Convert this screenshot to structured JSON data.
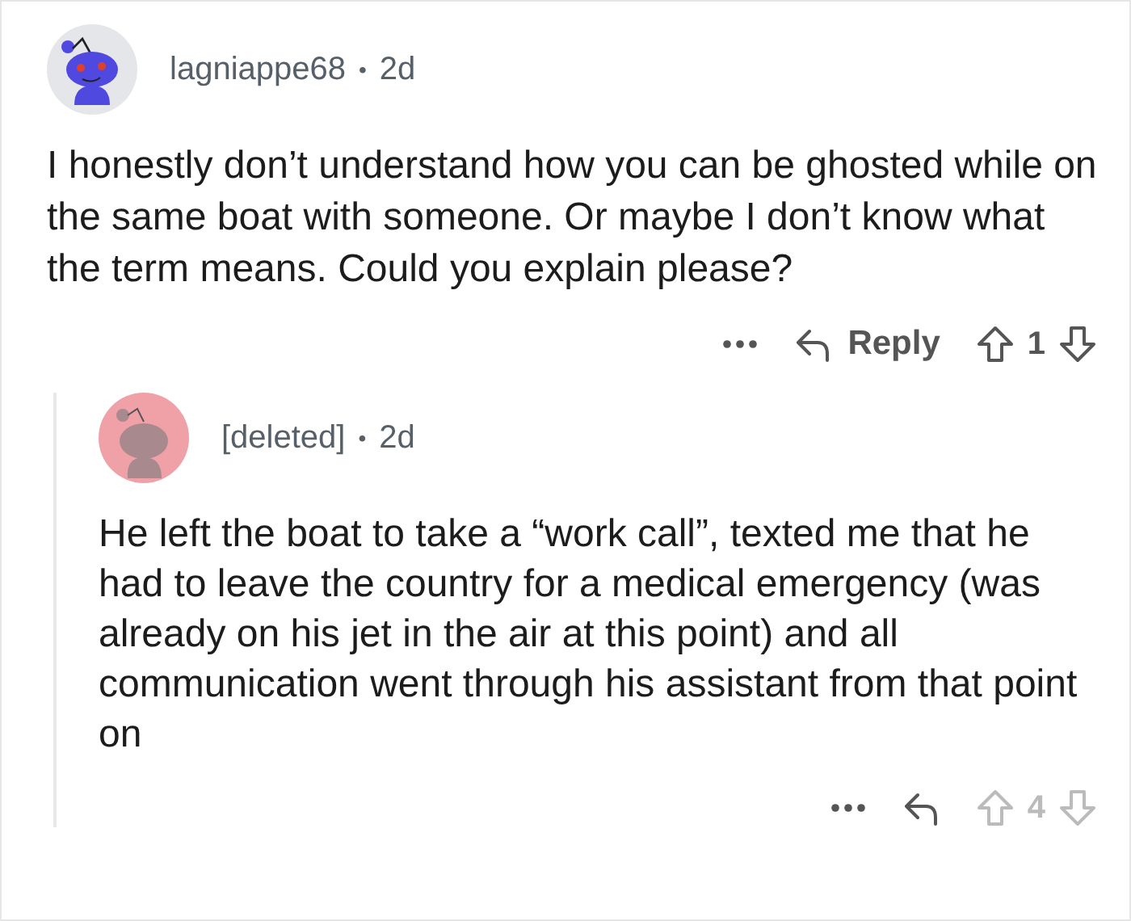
{
  "comment": {
    "avatar": {
      "kind": "snoo"
    },
    "author": "lagniappe68",
    "separator": "•",
    "time": "2d",
    "body": "I honestly don’t understand how you can be ghosted while on the same boat with someone. Or maybe I don’t know what the term means. Could you explain please?",
    "reply_label": "Reply",
    "score": "1",
    "votes_dimmed": false,
    "replies": [
      {
        "avatar": {
          "kind": "deleted"
        },
        "author": "[deleted]",
        "separator": "•",
        "time": "2d",
        "body": "He left the boat to take a “work call”, texted me that he had to leave the country for a medical emergency (was already on his jet in the air at this point) and all communication went through his assistant from that point on",
        "score": "4",
        "votes_dimmed": true
      }
    ]
  }
}
